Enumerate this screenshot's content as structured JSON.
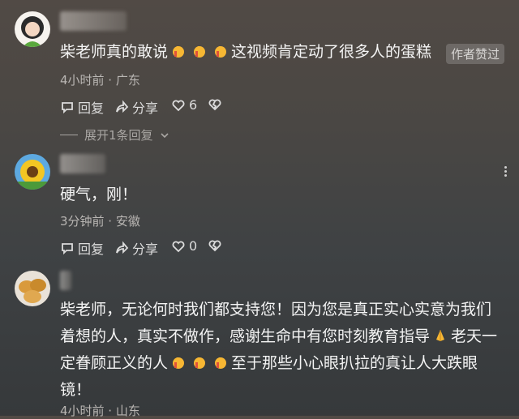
{
  "comments": [
    {
      "text_parts": [
        "柴老师真的敢说",
        "",
        "",
        "这视频肯定动了很多人的蛋糕"
      ],
      "badge": "作者赞过",
      "meta": "4小时前 · 广东",
      "reply_label": "回复",
      "share_label": "分享",
      "likes": "6",
      "expand_label": "展开1条回复"
    },
    {
      "text": "硬气，刚！",
      "meta": "3分钟前 · 安徽",
      "reply_label": "回复",
      "share_label": "分享",
      "likes": "0"
    },
    {
      "line1": "柴老师，无论何时我们都支持您！因为您是真正实心实意为我们",
      "line2": "着想的人，真实不做作，感谢生命中有您时刻教育指导",
      "line3a": "老天一",
      "line3": "定眷顾正义的人",
      "line3b": "至于那些小心眼扒拉的真让人大跌眼",
      "line4": "镜！",
      "meta": "4小时前 · 山东"
    }
  ],
  "icons": {
    "thumb_emoji": "thumbs-up-emoji",
    "pray_emoji": "praying-hands-emoji",
    "reply": "comment-icon",
    "share": "share-arrow-icon",
    "like": "heart-icon",
    "dislike": "broken-heart-icon",
    "more": "more-vertical-icon"
  },
  "colors": {
    "emoji_yellow": "#f7b733",
    "text": "#f4f4f4",
    "meta": "#b9b6b3"
  }
}
